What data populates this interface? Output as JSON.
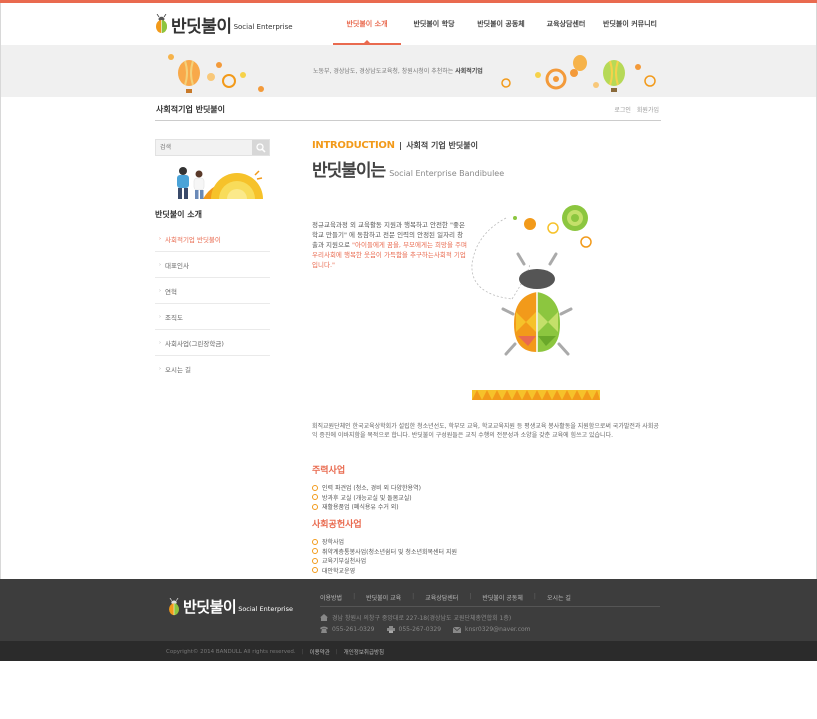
{
  "brand": {
    "name_ko": "반딧불이",
    "name_en": "Social Enterprise"
  },
  "gnb": {
    "items": [
      {
        "label": "반딧불이 소개",
        "active": true
      },
      {
        "label": "반딧불이 학당",
        "active": false
      },
      {
        "label": "반딧불이 공동체",
        "active": false
      },
      {
        "label": "교육상담센터",
        "active": false
      },
      {
        "label": "반딧불이 커뮤니티",
        "active": false
      }
    ]
  },
  "banner": {
    "text": "노동부, 경상남도, 경상남도교육청, 창원시청이 추천하는 ",
    "text_bold": "사회적기업"
  },
  "subbar": {
    "title": "사회적기업 반딧불이",
    "login": "로그인",
    "join": "회원가입"
  },
  "search": {
    "placeholder": "검색"
  },
  "lnb": {
    "title": "반딧불이 소개",
    "items": [
      {
        "label": "사회적기업 반딧불이",
        "active": true
      },
      {
        "label": "대표인사",
        "active": false
      },
      {
        "label": "연혁",
        "active": false
      },
      {
        "label": "조직도",
        "active": false
      },
      {
        "label": "사회사업(그린장학금)",
        "active": false
      },
      {
        "label": "오시는 길",
        "active": false
      }
    ]
  },
  "content": {
    "intro_en": "INTRODUCTION",
    "intro_ko": "사회적 기업 반딧불이",
    "title_ko": "반딧불이는",
    "title_en": "Social Enterprise Bandibulee",
    "lead_plain": "정규교육과정 외 교육활동 지원과 행복하고 안전한 \"좋은 학교 만들기\" 에 동참하고 전문 인력의 안정된 일자리 창출과 지원으로 ",
    "lead_highlight": "\"아이들에게 꿈을, 부모에게는 희망을 주며 우리사회에 행복한 웃음이 가득함을 추구하는사회적 기업입니다.\"",
    "description": "회직교원단체인 한국교육상학회가 설립한 청소년선도, 학부모 교육, 학교교육지원 등 평생교육 봉사활동을 지원함으로써 국가발전과 사회공익 증진에 이바지함을 목적으로 합니다. 반딧불이 구성원들은 교직 수행의 전문성과 소양을 갖춘 교육에 힘쓰고 있습니다.",
    "section1_title": "주력사업",
    "section1_items": [
      "인력 파견업 (청소, 경비 외 다양한용역)",
      "방과후 교실 (개능교실 및 돌봄교실)",
      "재활용품업 (폐식용유 수거 외)"
    ],
    "section2_title": "사회공헌사업",
    "section2_items": [
      "장학사업",
      "취약계층통봉사업(청소년쉼터 및 청소년회복센터 지원",
      "교육기부실천사업",
      "대안학교운영"
    ]
  },
  "footer": {
    "nav": [
      "이용방법",
      "반딧불이 교육",
      "교육상담센터",
      "반딧불이 공동체",
      "오시는 길"
    ],
    "address": "경남 창원시 의창구 중앙대로 227-18(경상남도 교원단체총연합회 1층)",
    "phone": "055-261-0329",
    "fax": "055-267-0329",
    "email": "knsr0329@naver.com",
    "copyright": "Copyright© 2014 BANDULL All rights reserved.",
    "terms": "이용약관",
    "privacy": "개인정보취급방침"
  },
  "colors": {
    "accent": "#e96a4f",
    "orange": "#f29a1a",
    "green": "#8cc63f",
    "footer_bg": "#3d3d3d"
  }
}
